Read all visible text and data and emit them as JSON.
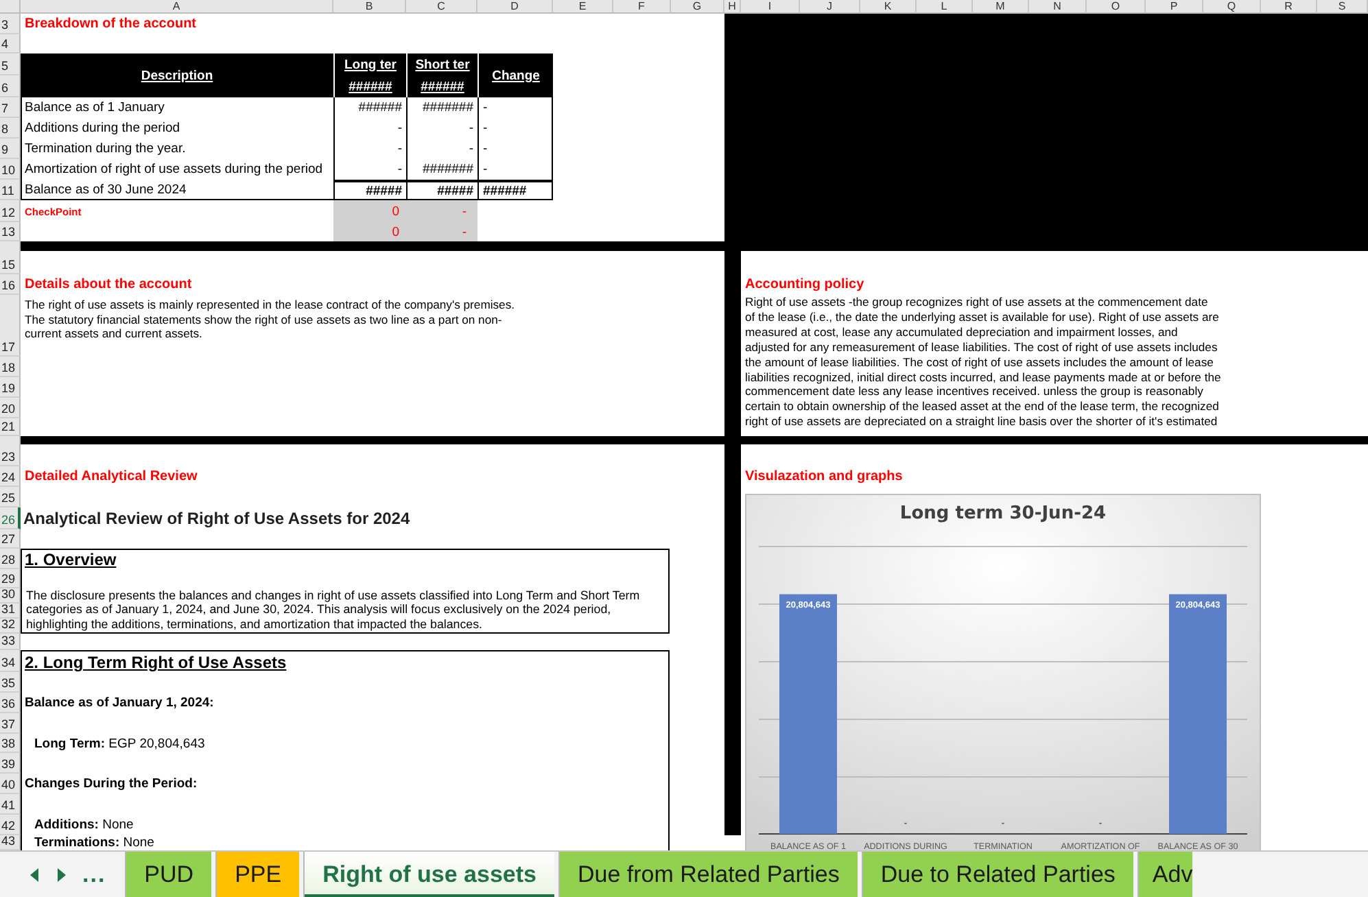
{
  "columns": [
    "A",
    "B",
    "C",
    "D",
    "E",
    "F",
    "G",
    "H",
    "I",
    "J",
    "K",
    "L",
    "M",
    "N",
    "O",
    "P",
    "Q",
    "R",
    "S"
  ],
  "rows": [
    {
      "label": "3",
      "selected": false
    },
    {
      "label": "4",
      "selected": false
    },
    {
      "label": "5",
      "selected": false
    },
    {
      "label": "6",
      "selected": false
    },
    {
      "label": "7",
      "selected": false
    },
    {
      "label": "8",
      "selected": false
    },
    {
      "label": "9",
      "selected": false
    },
    {
      "label": "10",
      "selected": false
    },
    {
      "label": "11",
      "selected": false
    },
    {
      "label": "12",
      "selected": false
    },
    {
      "label": "13",
      "selected": false
    },
    {
      "label": "15",
      "selected": false
    },
    {
      "label": "16",
      "selected": false
    },
    {
      "label": "17",
      "selected": false
    },
    {
      "label": "18",
      "selected": false
    },
    {
      "label": "19",
      "selected": false
    },
    {
      "label": "20",
      "selected": false
    },
    {
      "label": "21",
      "selected": false
    },
    {
      "label": "23",
      "selected": false
    },
    {
      "label": "24",
      "selected": false
    },
    {
      "label": "25",
      "selected": false
    },
    {
      "label": "26",
      "selected": true
    },
    {
      "label": "27",
      "selected": false
    },
    {
      "label": "28",
      "selected": false
    },
    {
      "label": "29",
      "selected": false
    },
    {
      "label": "30",
      "selected": false
    },
    {
      "label": "31",
      "selected": false
    },
    {
      "label": "32",
      "selected": false
    },
    {
      "label": "33",
      "selected": false
    },
    {
      "label": "34",
      "selected": false
    },
    {
      "label": "35",
      "selected": false
    },
    {
      "label": "36",
      "selected": false
    },
    {
      "label": "37",
      "selected": false
    },
    {
      "label": "38",
      "selected": false
    },
    {
      "label": "39",
      "selected": false
    },
    {
      "label": "40",
      "selected": false
    },
    {
      "label": "41",
      "selected": false
    },
    {
      "label": "42",
      "selected": false
    },
    {
      "label": "43",
      "selected": false
    }
  ],
  "breakdown": {
    "title": "Breakdown of the account",
    "headers": [
      {
        "label": "Description"
      },
      {
        "label": "Long ter",
        "sub": "######"
      },
      {
        "label": "Short ter",
        "sub": "######"
      },
      {
        "label": "Change"
      }
    ],
    "rows": [
      {
        "kind": "line",
        "cells": [
          "Balance as of 1 January",
          "######",
          "#######",
          "-"
        ]
      },
      {
        "kind": "line",
        "cells": [
          "Additions during the period",
          "-",
          "-",
          "-"
        ]
      },
      {
        "kind": "line",
        "cells": [
          "Termination during the year.",
          "-",
          "-",
          "-"
        ]
      },
      {
        "kind": "line",
        "cells": [
          "Amortization of right of use assets during the period",
          "-",
          "#######",
          "-"
        ]
      },
      {
        "kind": "total",
        "cells": [
          "Balance as of 30 June 2024",
          "#####",
          "#####",
          "######"
        ]
      }
    ],
    "checkpoint": {
      "label": "CheckPoint",
      "rows": [
        [
          "0",
          "-"
        ],
        [
          "0",
          "-"
        ]
      ]
    }
  },
  "details": {
    "title": "Details about the account",
    "text": "The right of use assets is mainly represented in the lease contract of the company's premises.\nThe statutory financial statements show the right of use assets as two line as a part on non-\ncurrent assets and current assets."
  },
  "policy": {
    "title": "Accounting policy",
    "text": "Right of use assets -the group recognizes right of use assets at the commencement date\nof the lease (i.e., the date  the underlying asset is available for use). Right of use assets are\nmeasured at cost, lease any accumulated depreciation and impairment losses, and\nadjusted for any remeasurement of lease liabilities. The cost of right of use assets includes\nthe amount of lease liabilities. The cost of right of use assets includes the amount of lease\nliabilities recognized, initial direct costs incurred, and lease payments made at or before the\ncommencement date less any lease incentives received. unless the group is reasonably\ncertain to obtain ownership of the leased asset at the end of the lease term, the recognized\nright of use assets are depreciated on a straight line basis over the shorter of it's estimated"
  },
  "review": {
    "title": "Detailed Analytical Review",
    "heading": "Analytical Review of Right of Use Assets for 2024",
    "overview": {
      "title": "1. Overview",
      "text": "The disclosure presents the balances and changes in right of use assets classified into Long Term and Short Term\ncategories as of January 1, 2024, and June 30, 2024. This analysis will focus exclusively on the 2024 period,\nhighlighting the additions, terminations, and amortization that impacted the balances."
    },
    "long_term": {
      "title": "2. Long Term Right of Use Assets",
      "lines": [
        {
          "kind": "heading",
          "text": "Balance as of January 1, 2024:"
        },
        {
          "kind": "item",
          "text": "**Long Term:** EGP 20,804,643"
        },
        {
          "kind": "heading",
          "text": "Changes During the Period:"
        },
        {
          "kind": "item",
          "text": "**Additions:** None"
        },
        {
          "kind": "item",
          "text": "**Terminations:** None"
        }
      ]
    }
  },
  "graphs": {
    "title": "Visulazation and graphs",
    "chart_data": {
      "type": "bar",
      "title": "Long term 30-Jun-24",
      "categories": [
        "BALANCE AS OF 1",
        "ADDITIONS DURING",
        "TERMINATION",
        "AMORTIZATION OF",
        "BALANCE AS OF 30"
      ],
      "values": [
        20804643,
        0,
        0,
        0,
        20804643
      ],
      "value_labels": [
        "20,804,643",
        "-",
        "-",
        "-",
        "20,804,643"
      ]
    }
  },
  "sheet_nav": {
    "more": "..."
  },
  "tabs": [
    {
      "label": "PUD",
      "color": "#92d050",
      "selected": false
    },
    {
      "label": "PPE",
      "color": "#ffc000",
      "selected": false
    },
    {
      "label": "Right of use assets",
      "color": "#217346",
      "selected": true
    },
    {
      "label": "Due from Related Parties",
      "color": "#92d050",
      "selected": false
    },
    {
      "label": "Due to Related Parties",
      "color": "#92d050",
      "selected": false
    },
    {
      "label": "Adv",
      "color": "#92d050",
      "selected": false
    }
  ]
}
